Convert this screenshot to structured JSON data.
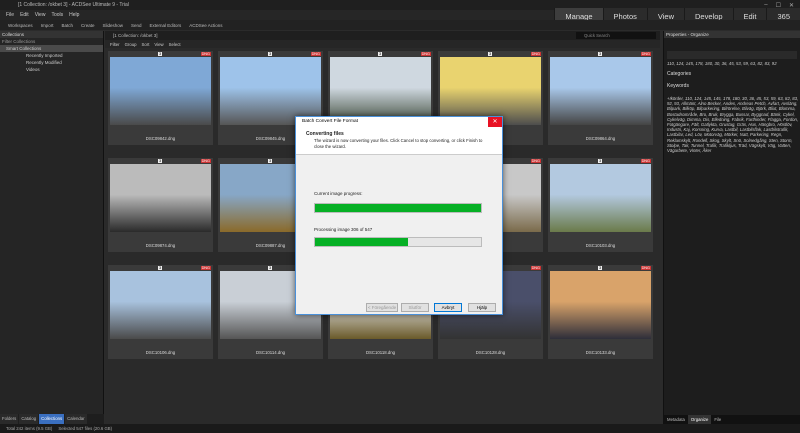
{
  "window": {
    "title": "[1 Collection: /okbet 3] - ACDSee Ultimate 9 - Trial"
  },
  "menu": [
    "File",
    "Edit",
    "View",
    "Tools",
    "Help"
  ],
  "modes": [
    {
      "label": "Manage",
      "active": true
    },
    {
      "label": "Photos",
      "active": false
    },
    {
      "label": "View",
      "active": false
    },
    {
      "label": "Develop",
      "active": false
    },
    {
      "label": "Edit",
      "active": false
    },
    {
      "label": "365",
      "active": false
    }
  ],
  "toolbar": [
    "Workspaces",
    "Import",
    "Batch",
    "Create",
    "Slideshow",
    "Send",
    "External Editors",
    "ACDSee Actions"
  ],
  "left_panel": {
    "title": "Collections",
    "subtitle": "Filter Collections",
    "items": [
      "Smart Collections",
      "Recently Imported",
      "Recently Modified",
      "Videos"
    ],
    "tabs": [
      "Folders",
      "Catalog",
      "Collections",
      "Calendar"
    ]
  },
  "center": {
    "path": "[1 Collection: /okbet 3]",
    "search_placeholder": "Quick Search",
    "filters": [
      "Filter",
      "Group",
      "Sort",
      "View",
      "Select"
    ],
    "thumbs": [
      {
        "name": "DSC09842.dng",
        "num": "3",
        "badge": "DNG"
      },
      {
        "name": "DSC09845.dng",
        "num": "3",
        "badge": "DNG"
      },
      {
        "name": "DSC09848.dng",
        "num": "3",
        "badge": "DNG"
      },
      {
        "name": "",
        "num": "3",
        "badge": "DNG"
      },
      {
        "name": "DSC09864.dng",
        "num": "3",
        "badge": "DNG"
      },
      {
        "name": "DSC09874.dng",
        "num": "3",
        "badge": "DNG"
      },
      {
        "name": "DSC09887.dng",
        "num": "3",
        "badge": "DNG"
      },
      {
        "name": "",
        "num": "3",
        "badge": "DNG"
      },
      {
        "name": "",
        "num": "3",
        "badge": "DNG"
      },
      {
        "name": "DSC10103.dng",
        "num": "3",
        "badge": "DNG"
      },
      {
        "name": "DSC10106.dng",
        "num": "3",
        "badge": "DNG"
      },
      {
        "name": "DSC10114.dng",
        "num": "3",
        "badge": "DNG"
      },
      {
        "name": "DSC10118.dng",
        "num": "3",
        "badge": "DNG"
      },
      {
        "name": "DSC10128.dng",
        "num": "3",
        "badge": "DNG"
      },
      {
        "name": "DSC10133.dng",
        "num": "3",
        "badge": "DNG"
      }
    ]
  },
  "right_panel": {
    "title": "Properties - Organize",
    "numbers": "110, 124, 145, 178, 180, 30, 36, 45, 53, 59, 63, 82, 83, 92",
    "categories": "Categories",
    "keywords": "Keywords",
    "keyword_text": "+Ikörder, 110, 124, 145, 145, 178, 180, 30, 36, 45, 53, 59, 63, 82, 83, 92, 93, Allmänt, Alno Becker, Andes, Andreas Petch, Avfart, Avsläng, Bilpark, Bilköp, Bilparkering, Bilrörelse, Bilväg, Björk, Blixt, Blomma, Bostadsområde, Bro, Bruk, Brygga, Bussar, Byggnad, Bänk, Cykel, Cykelväg, Dimma, Dis, Elledning, Fabrik, Farthinder, Flagga, Fordon, Fotgängare, Fält, Gatlykta, Grustag, Gräs, Hus, Hängbro, Höstlöv, Industri, Kaj, Korsning, Kurva, Lastbil, Lastbilsflak, Lastbilstrafik, Lastbilar, Led, Löv, Motorväg, Mörker, Natt, Parkering, Regn, Reklamskylt, Rondell, Skog, Skylt, Snö, Solnedgång, Sten, Storm, Stolpe, Tak, Tunnel, Trafik, Trafikljus, Träd, Vägskylt, Väg, Vatten, Vägarbete, Vinter, Åker",
    "tabs": [
      "Metadata",
      "Organize",
      "File"
    ]
  },
  "status": {
    "total": "Total 242 items (9.5 GB)",
    "selected": "Selected 547 files (20.6 GB)"
  },
  "dialog": {
    "title": "Batch Convert File Format",
    "heading": "Converting files",
    "description": "The wizard is now converting your files. Click Cancel to stop converting, or click Finish to close the wizard.",
    "current_label": "Current image progress:",
    "current_progress": 1.0,
    "processing_label": "Processing image 306 of 547",
    "overall_progress": 0.56,
    "buttons": {
      "back": "< Föregående",
      "finish": "Slutför",
      "cancel": "Avbryt",
      "help": "Hjälp"
    }
  },
  "colors": {
    "progress": "#06b025",
    "accent": "#3a6fc0",
    "close": "#e81123"
  }
}
